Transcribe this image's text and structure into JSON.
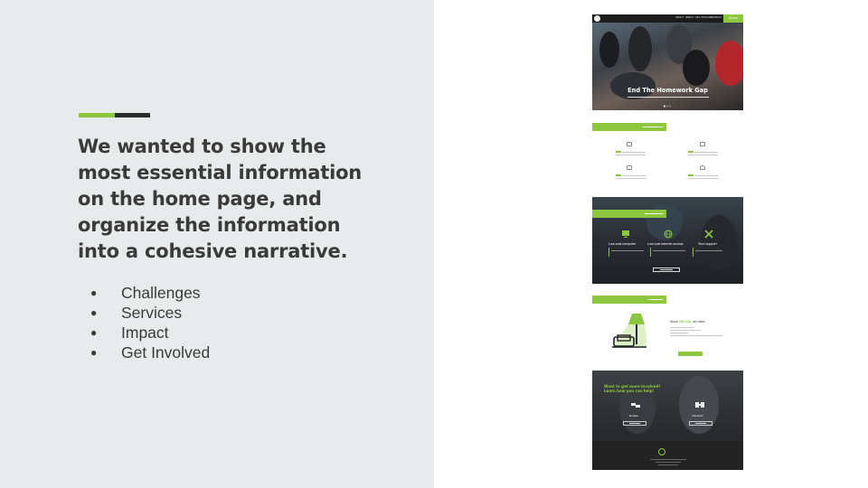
{
  "colors": {
    "accent_green": "#8dc63f",
    "dark_bar": "#2b2b2b",
    "left_panel": "#e8ebec",
    "heading_text": "#3a3a3a"
  },
  "slide": {
    "heading": "We wanted to show the most essential information on the home page, and organize the information into a cohesive narrative.",
    "bullet_char": "●",
    "bullets": [
      "Challenges",
      "Services",
      "Impact",
      "Get Involved"
    ]
  },
  "mockup": {
    "hero": {
      "title": "End The Homework Gap",
      "nav_links": [
        "ABOUT",
        "IMPACT",
        "GET INVOLVED",
        "CONTACT"
      ],
      "donate_label": "DONATE"
    },
    "services": {
      "items": [
        "Low-cost computer",
        "Low-cost internet access",
        "Tech support"
      ]
    },
    "impact": {
      "heading_prefix": "Since",
      "heading_number": "200,000,",
      "heading_suffix": "we have:"
    },
    "involved": {
      "heading_line1": "Want to get more involved?",
      "heading_line2": "Learn how you can help!",
      "options": [
        "Donate",
        "Volunteer"
      ]
    }
  }
}
